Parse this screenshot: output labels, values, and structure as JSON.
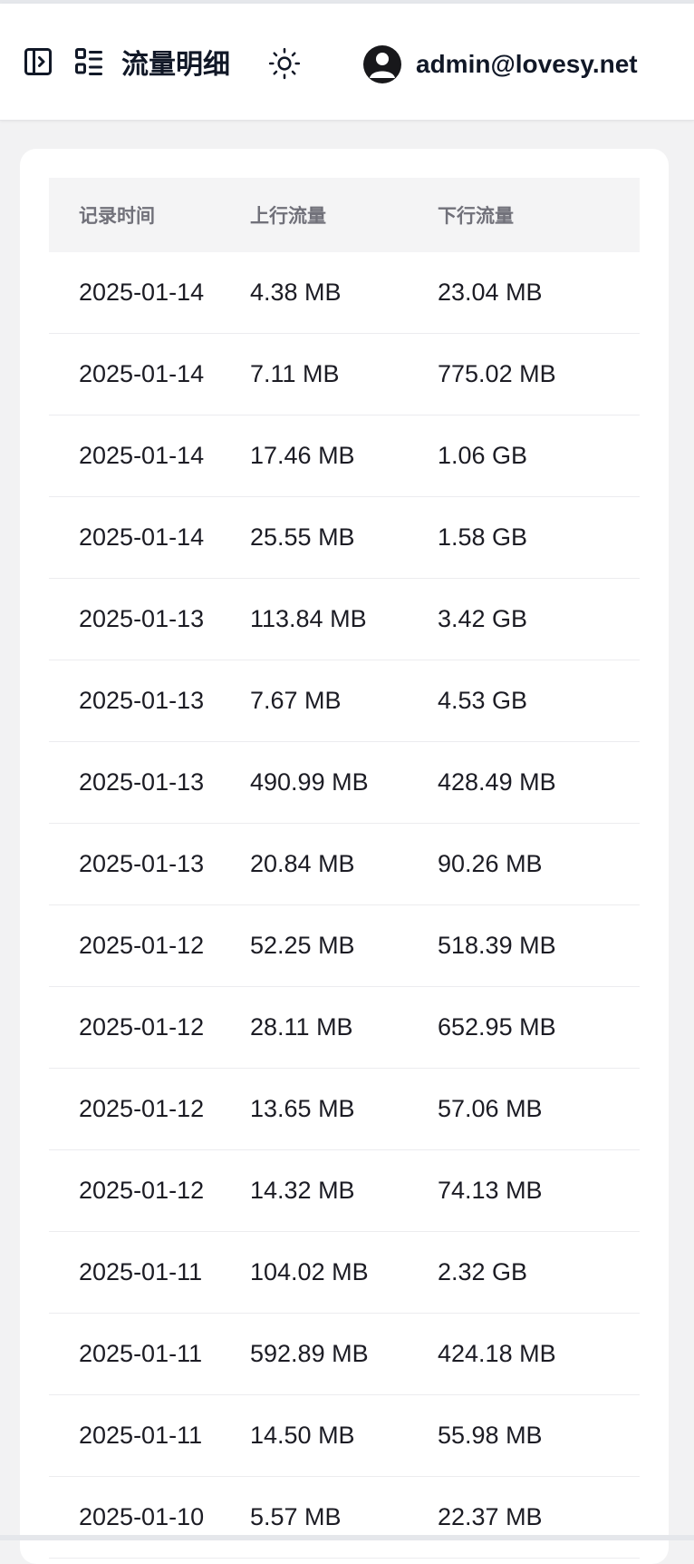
{
  "header": {
    "title": "流量明细",
    "user_email": "admin@lovesy.net",
    "icons": {
      "sidebar_toggle": "sidebar-toggle-icon",
      "list": "list-icon",
      "theme": "sun-icon",
      "avatar": "user-avatar-icon"
    }
  },
  "table": {
    "columns": [
      "记录时间",
      "上行流量",
      "下行流量"
    ],
    "rows": [
      [
        "2025-01-14",
        "4.38 MB",
        "23.04 MB"
      ],
      [
        "2025-01-14",
        "7.11 MB",
        "775.02 MB"
      ],
      [
        "2025-01-14",
        "17.46 MB",
        "1.06 GB"
      ],
      [
        "2025-01-14",
        "25.55 MB",
        "1.58 GB"
      ],
      [
        "2025-01-13",
        "113.84 MB",
        "3.42 GB"
      ],
      [
        "2025-01-13",
        "7.67 MB",
        "4.53 GB"
      ],
      [
        "2025-01-13",
        "490.99 MB",
        "428.49 MB"
      ],
      [
        "2025-01-13",
        "20.84 MB",
        "90.26 MB"
      ],
      [
        "2025-01-12",
        "52.25 MB",
        "518.39 MB"
      ],
      [
        "2025-01-12",
        "28.11 MB",
        "652.95 MB"
      ],
      [
        "2025-01-12",
        "13.65 MB",
        "57.06 MB"
      ],
      [
        "2025-01-12",
        "14.32 MB",
        "74.13 MB"
      ],
      [
        "2025-01-11",
        "104.02 MB",
        "2.32 GB"
      ],
      [
        "2025-01-11",
        "592.89 MB",
        "424.18 MB"
      ],
      [
        "2025-01-11",
        "14.50 MB",
        "55.98 MB"
      ],
      [
        "2025-01-10",
        "5.57 MB",
        "22.37 MB"
      ]
    ]
  }
}
